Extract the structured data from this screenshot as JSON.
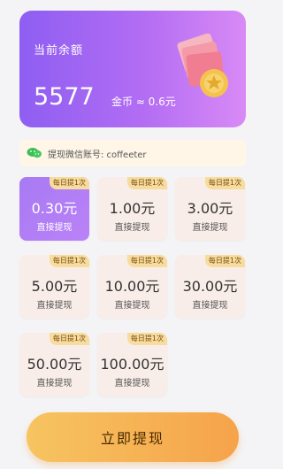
{
  "balance": {
    "label": "当前余额",
    "amount": "5577",
    "unit": "金币 ≈ 0.6元"
  },
  "wechat": {
    "text": "提现微信账号: coffeeter",
    "icon": "wechat-icon"
  },
  "options": [
    {
      "value": "0.30元",
      "subtitle": "直接提现",
      "badge": "每日提1次",
      "selected": true
    },
    {
      "value": "1.00元",
      "subtitle": "直接提现",
      "badge": "每日提1次"
    },
    {
      "value": "3.00元",
      "subtitle": "直接提现",
      "badge": "每日提1次"
    },
    {
      "value": "5.00元",
      "subtitle": "直接提现",
      "badge": "每日提1次"
    },
    {
      "value": "10.00元",
      "subtitle": "直接提现",
      "badge": "每日提1次"
    },
    {
      "value": "30.00元",
      "subtitle": "直接提现",
      "badge": "每日提1次"
    },
    {
      "value": "50.00元",
      "subtitle": "直接提现",
      "badge": "每日提1次"
    },
    {
      "value": "100.00元",
      "subtitle": "直接提现",
      "badge": "每日提1次"
    }
  ],
  "actions": {
    "withdraw_label": "立即提现"
  },
  "colors": {
    "card_gradient": [
      "#8e5ef2",
      "#d88af5"
    ],
    "selected_tile": "#a77af3",
    "tile_bg": "#f8ede8",
    "button_gradient": [
      "#f6c460",
      "#f6a34a"
    ]
  }
}
